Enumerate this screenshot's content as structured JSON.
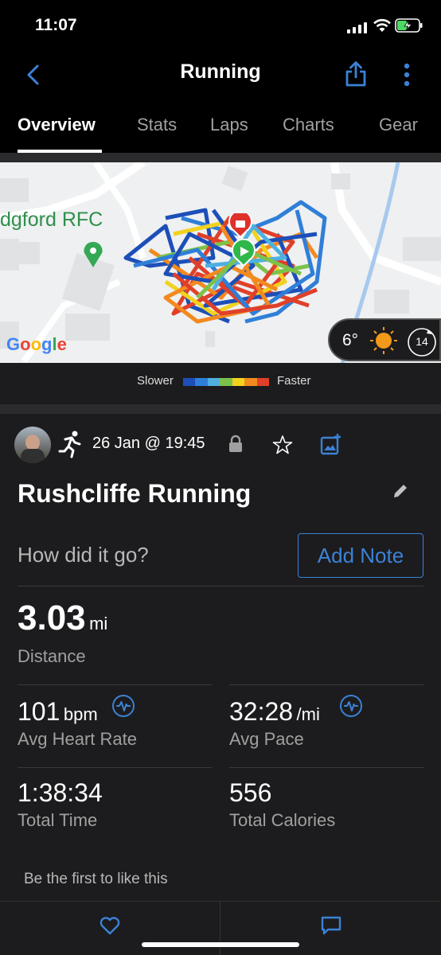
{
  "status_bar": {
    "time": "11:07"
  },
  "header": {
    "title": "Running"
  },
  "tabs": [
    {
      "label": "Overview",
      "active": true
    },
    {
      "label": "Stats"
    },
    {
      "label": "Laps"
    },
    {
      "label": "Charts"
    },
    {
      "label": "Gear"
    }
  ],
  "map": {
    "place_label": "dgford RFC",
    "attribution": "Google",
    "weather": {
      "temperature": "6°",
      "condition_icon": "sun-icon",
      "wind": "14"
    }
  },
  "legend": {
    "slow_label": "Slower",
    "fast_label": "Faster",
    "colors": [
      "#1d4fb8",
      "#2f7fd8",
      "#4fb0e0",
      "#7cc24b",
      "#f2d21f",
      "#f28a1f",
      "#e0402a"
    ]
  },
  "activity": {
    "date": "26 Jan @ 19:45",
    "name": "Rushcliffe Running",
    "note_prompt": "How did it go?",
    "add_note_label": "Add Note"
  },
  "stats": {
    "distance": {
      "value": "3.03",
      "unit": "mi",
      "label": "Distance"
    },
    "avg_hr": {
      "value": "101",
      "unit": "bpm",
      "label": "Avg Heart Rate"
    },
    "avg_pace": {
      "value": "32:28",
      "unit": "/mi",
      "label": "Avg Pace"
    },
    "total_time": {
      "value": "1:38:34",
      "label": "Total Time"
    },
    "calories": {
      "value": "556",
      "label": "Total Calories"
    }
  },
  "social": {
    "likes_text": "Be the first to like this"
  },
  "colors": {
    "accent": "#3b82d6",
    "background": "#1c1c1e",
    "map_label": "#2f8f4b"
  }
}
